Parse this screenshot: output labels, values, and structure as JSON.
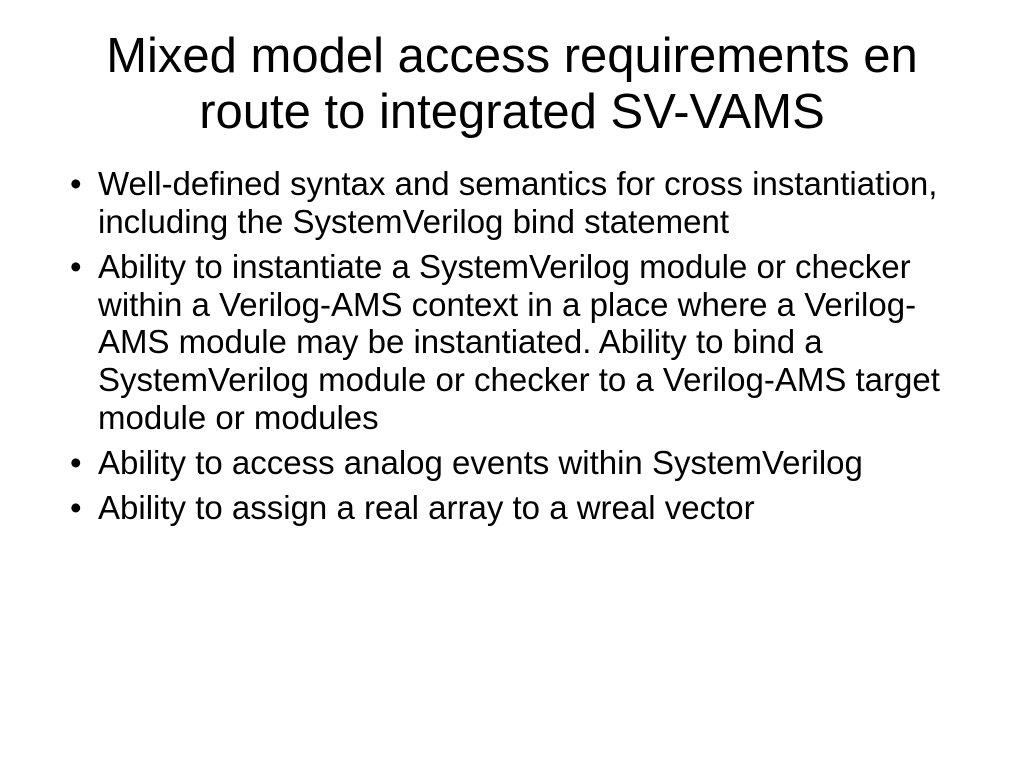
{
  "slide": {
    "title": "Mixed model access requirements en route to integrated SV-VAMS",
    "bullets": [
      "Well-defined syntax and semantics for cross instantiation, including the SystemVerilog bind statement",
      "Ability to instantiate a SystemVerilog module or checker within a Verilog-AMS context in a place where a Verilog-AMS module may be instantiated. Ability to bind a SystemVerilog module or checker to a Verilog-AMS target module or modules",
      "Ability to access analog events within SystemVerilog",
      "Ability to assign a real array to a wreal vector"
    ]
  }
}
